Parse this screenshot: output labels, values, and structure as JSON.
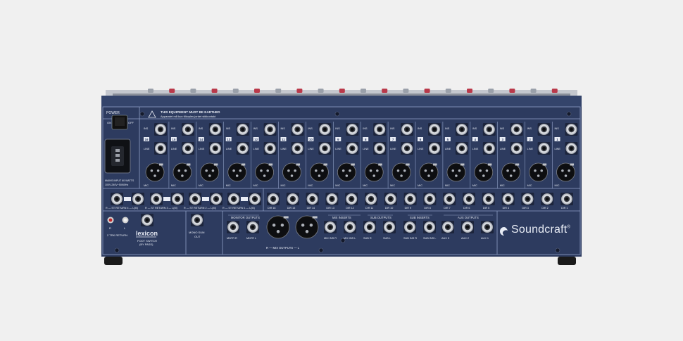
{
  "colors": {
    "background": "#f0f0f0",
    "panel": "#2d3b5f",
    "panel_dark": "#1d2742",
    "jack_metal": "#c9ccd3",
    "label": "#e8ecf5"
  },
  "power": {
    "label": "POWER",
    "on_label": "ON",
    "off_label": "OFF",
    "mains_spec_1": "MAINS INPUT 60 WATTS",
    "mains_spec_2": "100V-240V~50/60Hz"
  },
  "warning": {
    "line1": "THIS EQUIPMENT MUST BE EARTHED",
    "line2": "Apparatet må kun tilkoples jordet stikkontakt"
  },
  "mono_channels": [
    {
      "number": "16",
      "ins_label": "INS",
      "line_label": "LINE",
      "mic_label": "MIC"
    },
    {
      "number": "15",
      "ins_label": "INS",
      "line_label": "LINE",
      "mic_label": "MIC"
    },
    {
      "number": "14",
      "ins_label": "INS",
      "line_label": "LINE",
      "mic_label": "MIC"
    },
    {
      "number": "13",
      "ins_label": "INS",
      "line_label": "LINE",
      "mic_label": "MIC"
    },
    {
      "number": "12",
      "ins_label": "INS",
      "line_label": "LINE",
      "mic_label": "MIC"
    },
    {
      "number": "11",
      "ins_label": "INS",
      "line_label": "LINE",
      "mic_label": "MIC"
    },
    {
      "number": "10",
      "ins_label": "INS",
      "line_label": "LINE",
      "mic_label": "MIC"
    },
    {
      "number": "9",
      "ins_label": "INS",
      "line_label": "LINE",
      "mic_label": "MIC"
    },
    {
      "number": "8",
      "ins_label": "INS",
      "line_label": "LINE",
      "mic_label": "MIC"
    },
    {
      "number": "7",
      "ins_label": "INS",
      "line_label": "LINE",
      "mic_label": "MIC"
    },
    {
      "number": "6",
      "ins_label": "INS",
      "line_label": "LINE",
      "mic_label": "MIC"
    },
    {
      "number": "5",
      "ins_label": "INS",
      "line_label": "LINE",
      "mic_label": "MIC"
    },
    {
      "number": "4",
      "ins_label": "INS",
      "line_label": "LINE",
      "mic_label": "MIC"
    },
    {
      "number": "3",
      "ins_label": "INS",
      "line_label": "LINE",
      "mic_label": "MIC"
    },
    {
      "number": "2",
      "ins_label": "INS",
      "line_label": "LINE",
      "mic_label": "MIC"
    },
    {
      "number": "1",
      "ins_label": "INS",
      "line_label": "LINE",
      "mic_label": "MIC"
    }
  ],
  "stereo_returns": [
    {
      "label": "R — ST RETURN 4 — L(M)"
    },
    {
      "label": "R — ST RETURN 3 — L(M)"
    },
    {
      "label": "R — ST RETURN 2 — L(M)"
    },
    {
      "label": "R — ST RETURN 1 — L(M)"
    }
  ],
  "direct_outs": [
    "DIR 16",
    "DIR 15",
    "DIR 14",
    "DIR 13",
    "DIR 12",
    "DIR 11",
    "DIR 10",
    "DIR 9",
    "DIR 8",
    "DIR 7",
    "DIR 6",
    "DIR 5",
    "DIR 4",
    "DIR 3",
    "DIR 2",
    "DIR 1"
  ],
  "two_track_return": {
    "label": "2 TRK RETURN",
    "r_label": "R",
    "l_label": "L"
  },
  "lexicon": {
    "logo": "lexicon",
    "footswitch_1": "FOOT SWITCH",
    "footswitch_2": "(BY PASS)"
  },
  "mono_sum": {
    "label_1": "MONO SUM",
    "label_2": "OUT"
  },
  "monitor_outputs": {
    "title": "MONITOR OUTPUTS",
    "jacks": [
      "MNTR R",
      "MNTR L"
    ]
  },
  "mix_outputs": {
    "label": "R — MIX OUTPUTS — L"
  },
  "mix_inserts": {
    "title": "MIX INSERTS",
    "jacks": [
      "MIX INS R",
      "MIX INS L"
    ]
  },
  "sub_outputs": {
    "title": "SUB OUTPUTS",
    "jacks": [
      "SUB R",
      "SUB L"
    ]
  },
  "sub_inserts": {
    "title": "SUB INSERTS",
    "jacks": [
      "SUB INS R",
      "SUB INS L"
    ]
  },
  "aux_outputs": {
    "title": "AUX OUTPUTS",
    "jacks": [
      "AUX 3",
      "AUX 2",
      "AUX 1"
    ]
  },
  "brand": {
    "name": "Soundcraft",
    "mark": "®"
  }
}
